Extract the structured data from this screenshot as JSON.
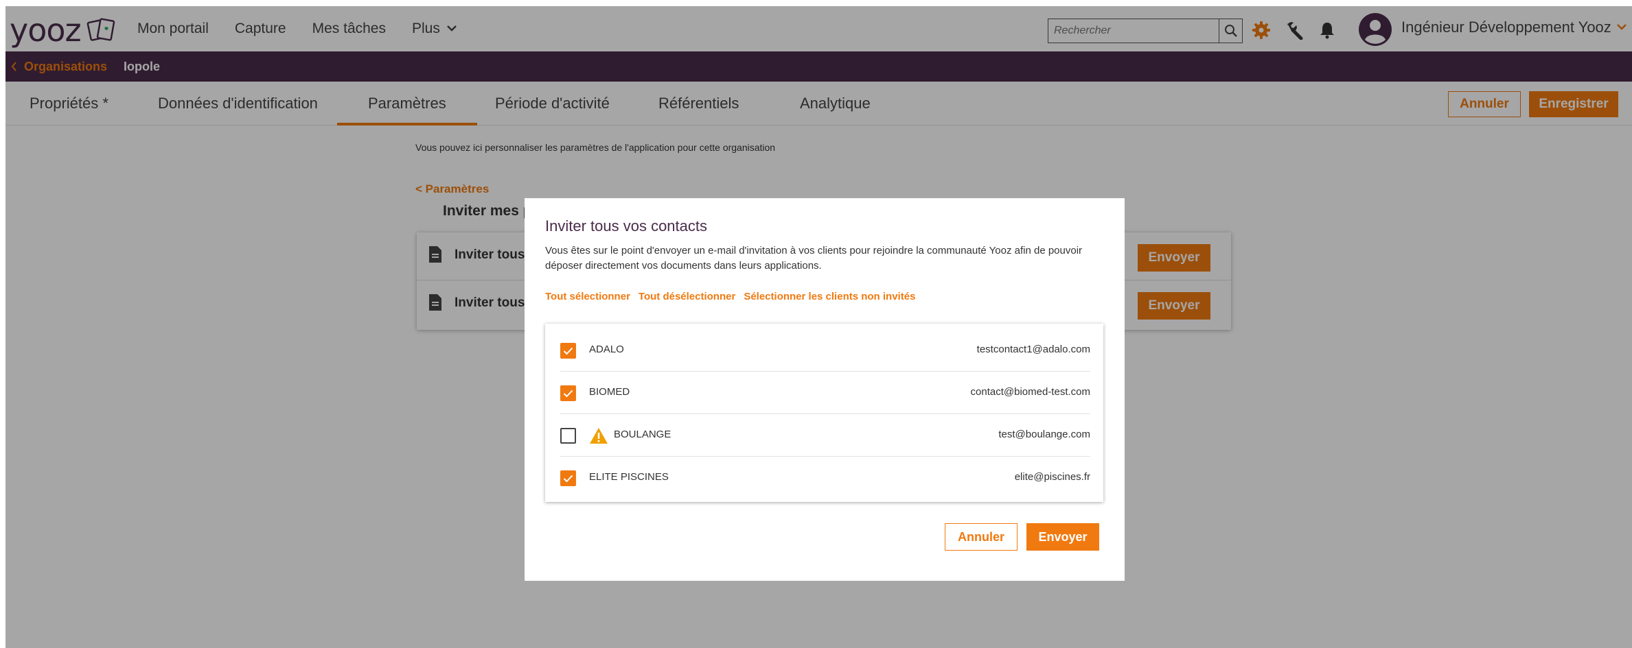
{
  "header": {
    "logo_text": "yooz",
    "nav": [
      "Mon portail",
      "Capture",
      "Mes tâches",
      "Plus"
    ],
    "search_placeholder": "Rechercher",
    "user_name": "Ingénieur Développement Yooz",
    "icons": [
      "search-icon",
      "gear-icon",
      "wrench-icon",
      "bell-icon",
      "avatar-icon",
      "chevron-down-icon"
    ]
  },
  "breadcrumb": {
    "back_label": "Organisations",
    "current": "Iopole"
  },
  "tabs": [
    "Propriétés *",
    "Données d'identification",
    "Paramètres",
    "Période d'activité",
    "Référentiels",
    "Analytique"
  ],
  "active_tab": "Paramètres",
  "toolbar": {
    "cancel_label": "Annuler",
    "save_label": "Enregistrer"
  },
  "page": {
    "intro": "Vous pouvez ici personnaliser les paramètres de l'application pour cette organisation",
    "back_link": "< Paramètres",
    "section_title": "Inviter mes p",
    "rows": [
      {
        "label": "Inviter tous",
        "send_label": "Envoyer"
      },
      {
        "label": "Inviter tous",
        "send_label": "Envoyer"
      }
    ]
  },
  "modal": {
    "title": "Inviter tous vos contacts",
    "description": "Vous êtes sur le point d'envoyer un e-mail d'invitation à vos clients pour rejoindre la communauté Yooz afin de pouvoir déposer directement vos documents dans leurs applications.",
    "links": [
      "Tout sélectionner",
      "Tout désélectionner",
      "Sélectionner les clients non invités"
    ],
    "contacts": [
      {
        "name": "ADALO",
        "email": "testcontact1@adalo.com",
        "checked": true,
        "warning": false
      },
      {
        "name": "BIOMED",
        "email": "contact@biomed-test.com",
        "checked": true,
        "warning": false
      },
      {
        "name": "BOULANGE",
        "email": "test@boulange.com",
        "checked": false,
        "warning": true
      },
      {
        "name": "ELITE PISCINES",
        "email": "elite@piscines.fr",
        "checked": true,
        "warning": false
      }
    ],
    "cancel_label": "Annuler",
    "send_label": "Envoyer"
  },
  "colors": {
    "accent": "#f07a10",
    "brand_purple": "#4a2c4a",
    "overlay": "rgba(0,0,0,0.35)"
  }
}
